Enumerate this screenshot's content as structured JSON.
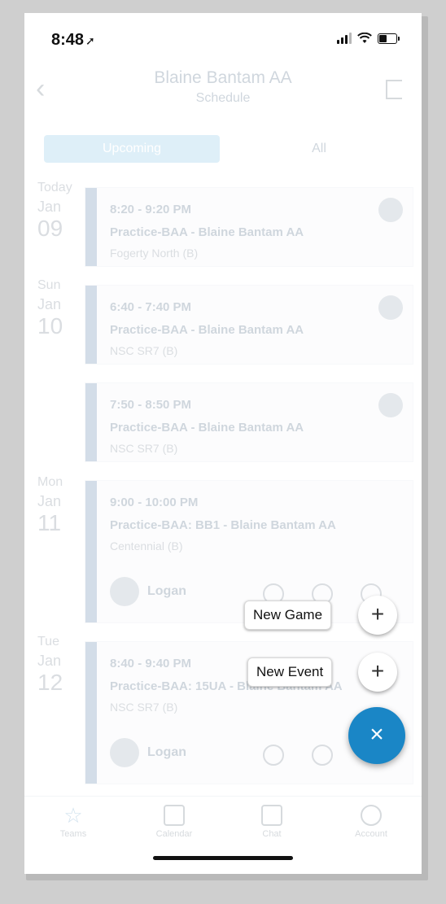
{
  "status_bar": {
    "time": "8:48",
    "location_glyph": "➚"
  },
  "nav": {
    "title": "Blaine Bantam AA",
    "subtitle": "Schedule",
    "back_glyph": "‹"
  },
  "tabs": [
    {
      "label": "Upcoming",
      "active": true
    },
    {
      "label": "All",
      "active": false
    }
  ],
  "days": [
    {
      "dow": "Today",
      "mon": "Jan",
      "day": "09"
    },
    {
      "dow": "Sun",
      "mon": "Jan",
      "day": "10"
    },
    {
      "dow": "Mon",
      "mon": "Jan",
      "day": "11"
    },
    {
      "dow": "Tue",
      "mon": "Jan",
      "day": "12"
    }
  ],
  "events": [
    {
      "time": "8:20 - 9:20 PM",
      "title": "Practice-BAA - Blaine Bantam AA",
      "location": "Fogerty North (B)"
    },
    {
      "time": "6:40 - 7:40 PM",
      "title": "Practice-BAA - Blaine Bantam AA",
      "location": "NSC SR7 (B)"
    },
    {
      "time": "7:50 - 8:50 PM",
      "title": "Practice-BAA - Blaine Bantam AA",
      "location": "NSC SR7 (B)"
    },
    {
      "time": "9:00 - 10:00 PM",
      "title": "Practice-BAA: BB1 - Blaine Bantam AA",
      "location": "Centennial (B)",
      "person": "Logan"
    },
    {
      "time": "8:40 - 9:40 PM",
      "title": "Practice-BAA: 15UA - Blaine Bantam AA",
      "location": "NSC SR7 (B)",
      "person": "Logan"
    }
  ],
  "bottom_tabs": [
    "Teams",
    "Calendar",
    "Chat",
    "Account"
  ],
  "fab_menu": {
    "new_game": "New Game",
    "new_event": "New Event",
    "plus_glyph": "+",
    "close_glyph": "×",
    "accent": "#1a86c6"
  }
}
